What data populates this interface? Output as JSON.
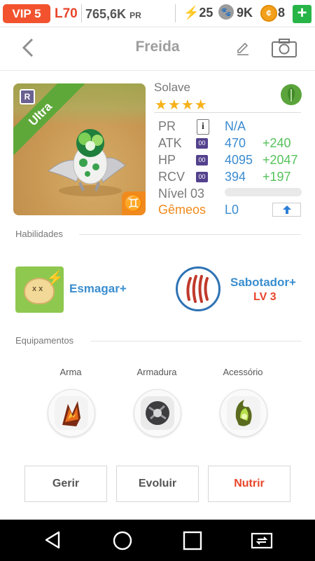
{
  "status": {
    "vip": "VIP 5",
    "level": "L70",
    "power": "765,6K",
    "power_unit": "PR",
    "energy_icon": "lightning-icon",
    "energy": "25",
    "paw_value": "9K",
    "coin_value": "8",
    "plus": "+"
  },
  "header": {
    "back": "‹",
    "title": "Freida",
    "edit_icon": "pencil-icon",
    "camera_icon": "camera-icon"
  },
  "card": {
    "rarity_ribbon": "Ultra",
    "rank_badge": "R",
    "zodiac_symbol": "♊"
  },
  "info": {
    "monster_name": "Solave",
    "stars": "★★★★",
    "element_icon": "leaf-icon",
    "stats": [
      {
        "label": "PR",
        "value": "N/A",
        "bonus": ""
      },
      {
        "label": "ATK",
        "badge": "00",
        "value": "470",
        "bonus": "+240"
      },
      {
        "label": "HP",
        "badge": "00",
        "value": "4095",
        "bonus": "+2047"
      },
      {
        "label": "RCV",
        "badge": "00",
        "value": "394",
        "bonus": "+197"
      }
    ],
    "level_label": "Nível 03",
    "level_progress": 0,
    "twins_label": "Gêmeos",
    "twins_value": "L0",
    "twins_icon": "up-arrow-icon"
  },
  "skills": {
    "section_title": "Habilidades",
    "items": [
      {
        "name": "Esmagar+",
        "level": ""
      },
      {
        "name": "Sabotador+",
        "level": "LV 3"
      }
    ]
  },
  "equipment": {
    "section_title": "Equipamentos",
    "slots": [
      {
        "label": "Arma"
      },
      {
        "label": "Armadura"
      },
      {
        "label": "Acessório"
      }
    ]
  },
  "actions": {
    "manage": "Gerir",
    "evolve": "Evoluir",
    "feed": "Nutrir"
  },
  "colors": {
    "accent_red": "#e8452a",
    "accent_blue": "#3c8bd0",
    "bonus_green": "#55c25a",
    "ribbon_green": "#5ea83a",
    "orange": "#f08a1d"
  }
}
